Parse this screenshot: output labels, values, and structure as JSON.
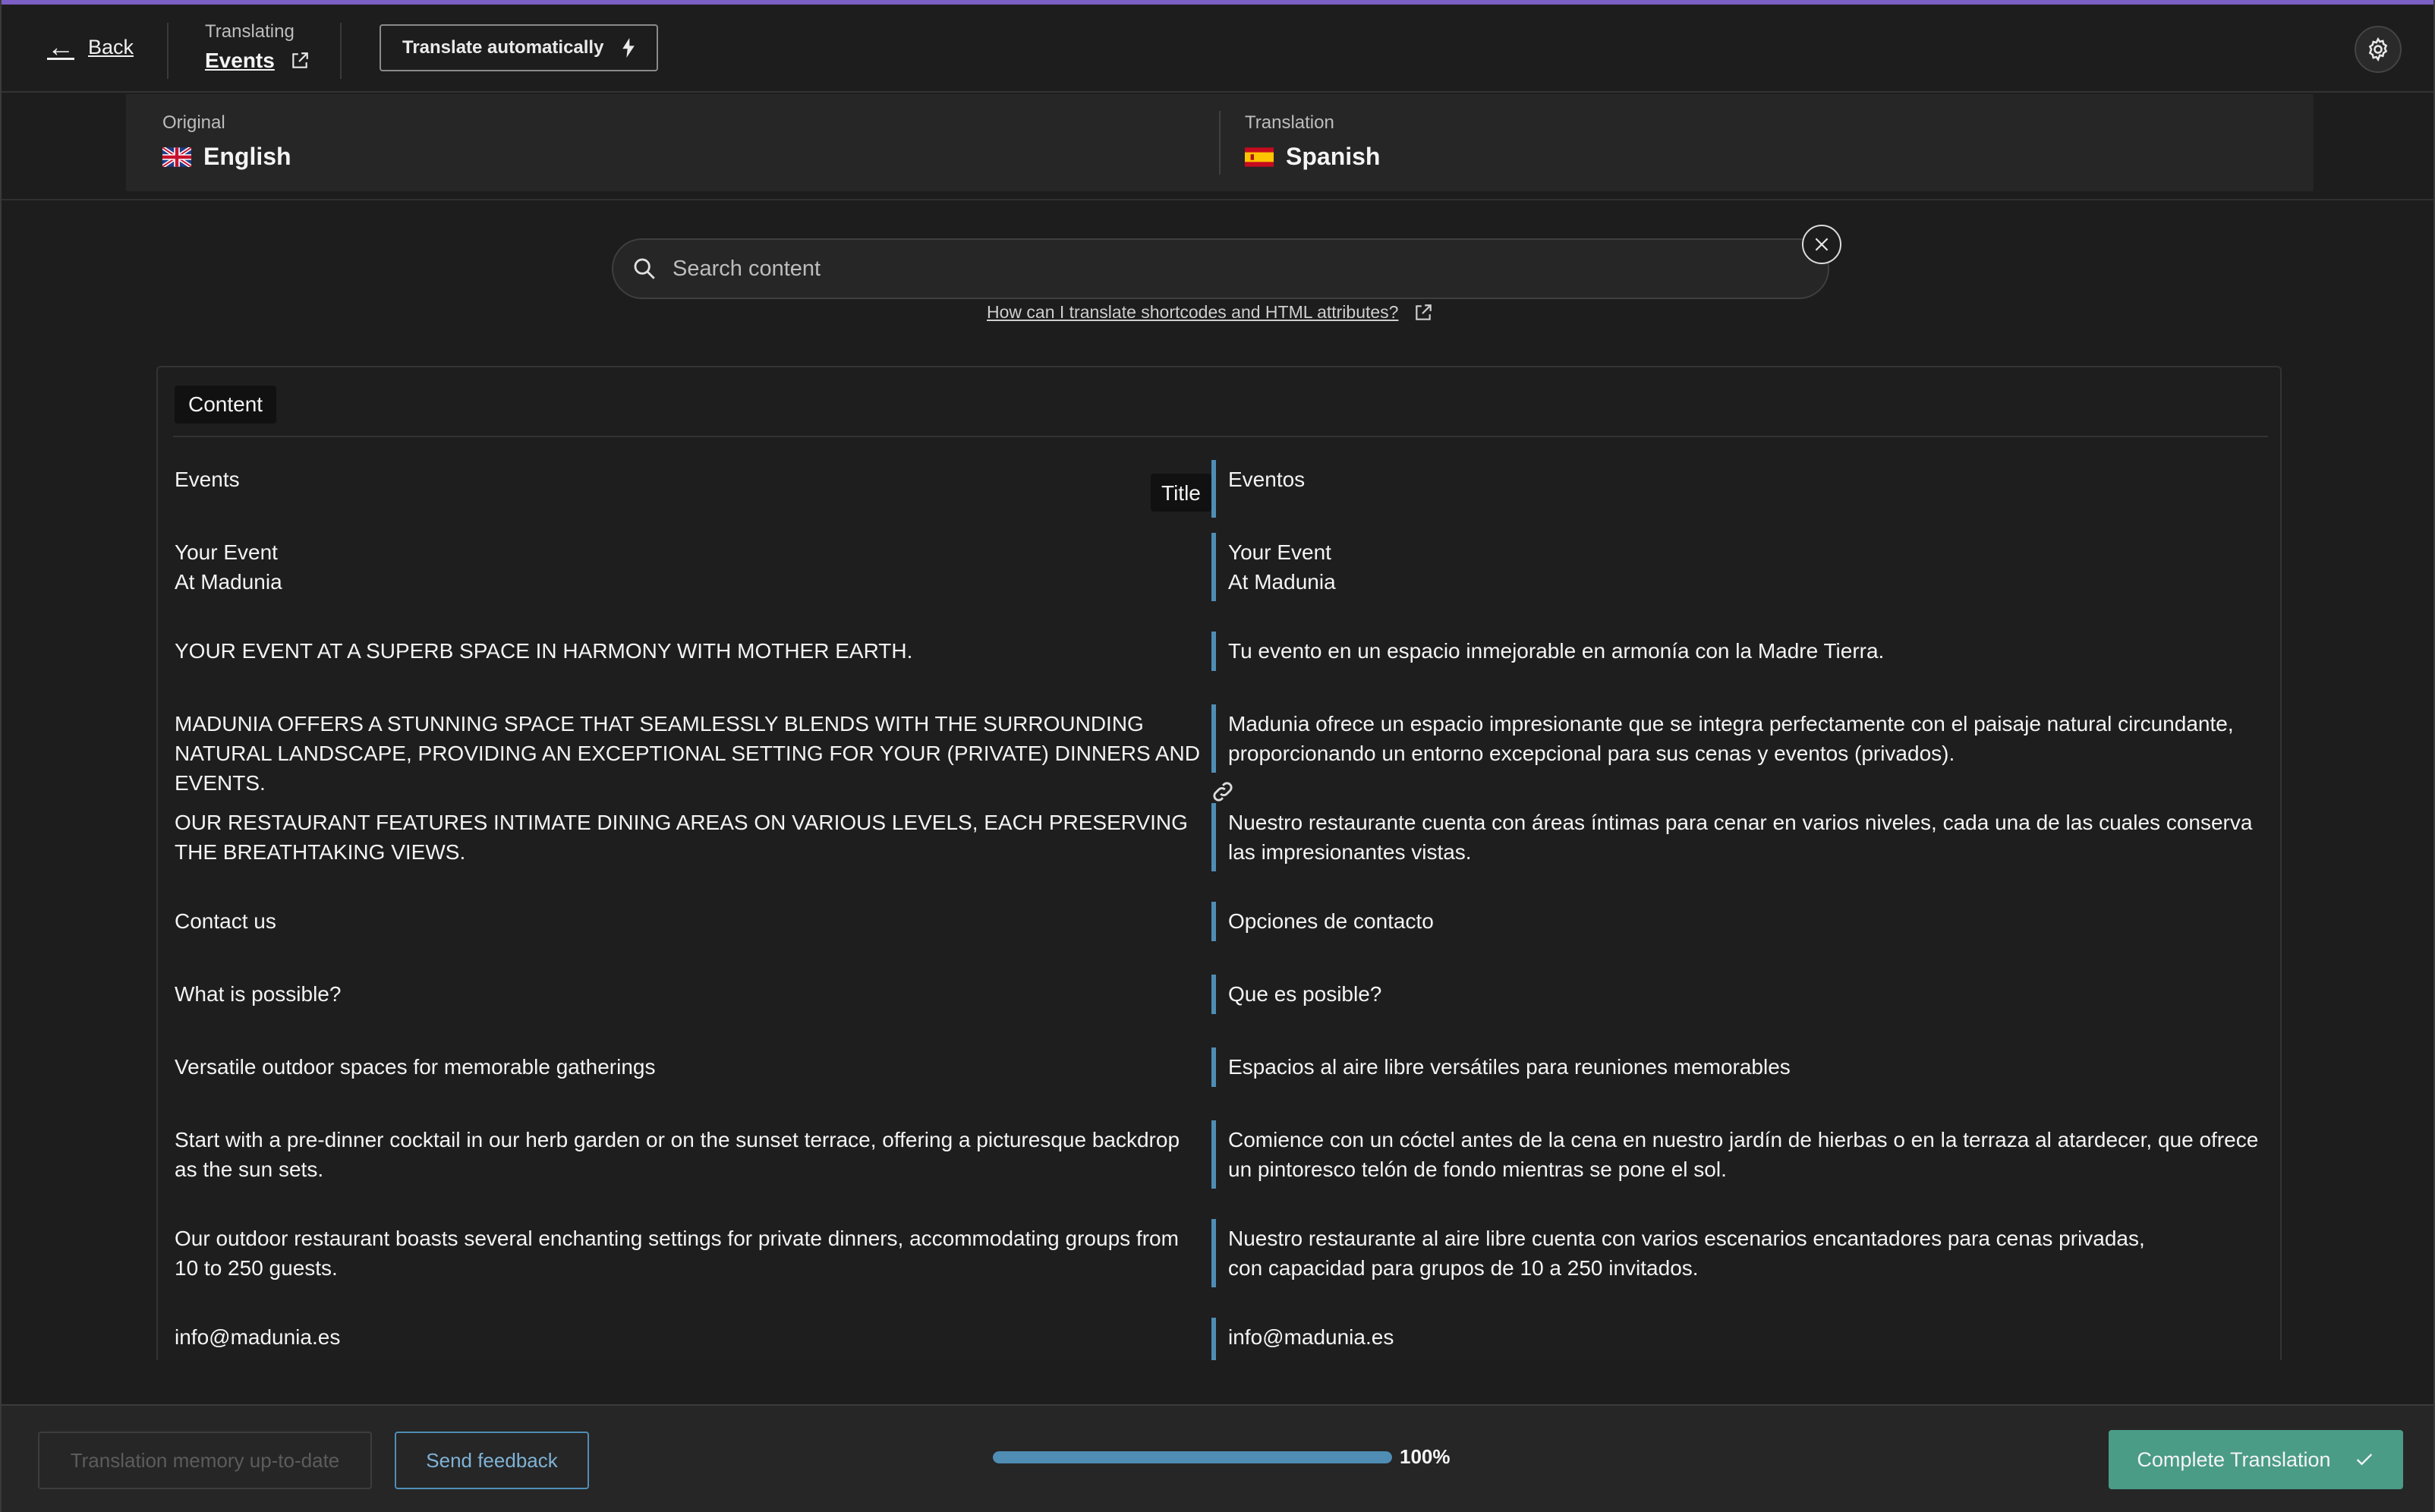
{
  "header": {
    "back_label": "Back",
    "translating_caption": "Translating",
    "post_title": "Events",
    "translate_auto_label": "Translate automatically"
  },
  "languages": {
    "original_caption": "Original",
    "original_name": "English",
    "translation_caption": "Translation",
    "translation_name": "Spanish"
  },
  "search": {
    "placeholder": "Search content",
    "help_link": "How can I translate shortcodes and HTML attributes?"
  },
  "content": {
    "section_tab": "Content",
    "title_badge": "Title",
    "rows": [
      {
        "original": "Events",
        "translation": "Eventos"
      },
      {
        "original": "Your Event\nAt Madunia",
        "translation": "Your Event\nAt Madunia"
      },
      {
        "original": "YOUR EVENT AT A SUPERB SPACE IN HARMONY WITH MOTHER EARTH.",
        "translation": "Tu evento en un espacio inmejorable en armonía con la Madre Tierra."
      },
      {
        "original": "MADUNIA OFFERS A STUNNING SPACE THAT SEAMLESSLY BLENDS WITH THE SURROUNDING NATURAL LANDSCAPE, PROVIDING AN EXCEPTIONAL SETTING FOR YOUR (PRIVATE) DINNERS AND EVENTS.",
        "translation": "Madunia ofrece un espacio impresionante que se integra perfectamente con el paisaje natural circundante, proporcionando un entorno excepcional para sus cenas y eventos (privados)."
      },
      {
        "original": "OUR RESTAURANT FEATURES INTIMATE DINING AREAS ON VARIOUS LEVELS, EACH PRESERVING THE BREATHTAKING VIEWS.",
        "translation": "Nuestro restaurante cuenta con áreas íntimas para cenar en varios niveles, cada una de las cuales conserva las impresionantes vistas."
      },
      {
        "original": "Contact us",
        "translation": "Opciones de contacto"
      },
      {
        "original": "What is possible?",
        "translation": "Que es posible?"
      },
      {
        "original": "Versatile outdoor spaces for memorable gatherings",
        "translation": "Espacios al aire libre versátiles para reuniones memorables"
      },
      {
        "original": "Start with a pre-dinner cocktail in our herb garden or on the sunset terrace, offering a picturesque backdrop as the sun sets.",
        "translation": "Comience con un cóctel antes de la cena en nuestro jardín de hierbas o en la terraza al atardecer, que ofrece un pintoresco telón de fondo mientras se pone el sol."
      },
      {
        "original": "Our outdoor restaurant boasts several enchanting settings for private dinners, accommodating groups from 10 to 250 guests.",
        "translation": "Nuestro restaurante al aire libre cuenta con varios escenarios encantadores para cenas privadas, con capacidad para grupos de 10 a 250 invitados."
      },
      {
        "original": "info@madunia.es",
        "translation": "info@madunia.es"
      }
    ]
  },
  "footer": {
    "memory_label": "Translation memory up-to-date",
    "feedback_label": "Send feedback",
    "progress_percent": 100,
    "progress_label": "100%",
    "complete_label": "Complete Translation"
  },
  "colors": {
    "accent_top": "#7b5fc4",
    "row_bar": "#4f8db5",
    "complete_button": "#4a9c86"
  },
  "icons": {
    "back": "arrow-left-icon",
    "external": "external-link-icon",
    "auto": "lightning-icon",
    "settings": "gear-icon",
    "search": "search-icon",
    "clear": "close-icon",
    "link": "link-icon",
    "check": "check-icon"
  }
}
